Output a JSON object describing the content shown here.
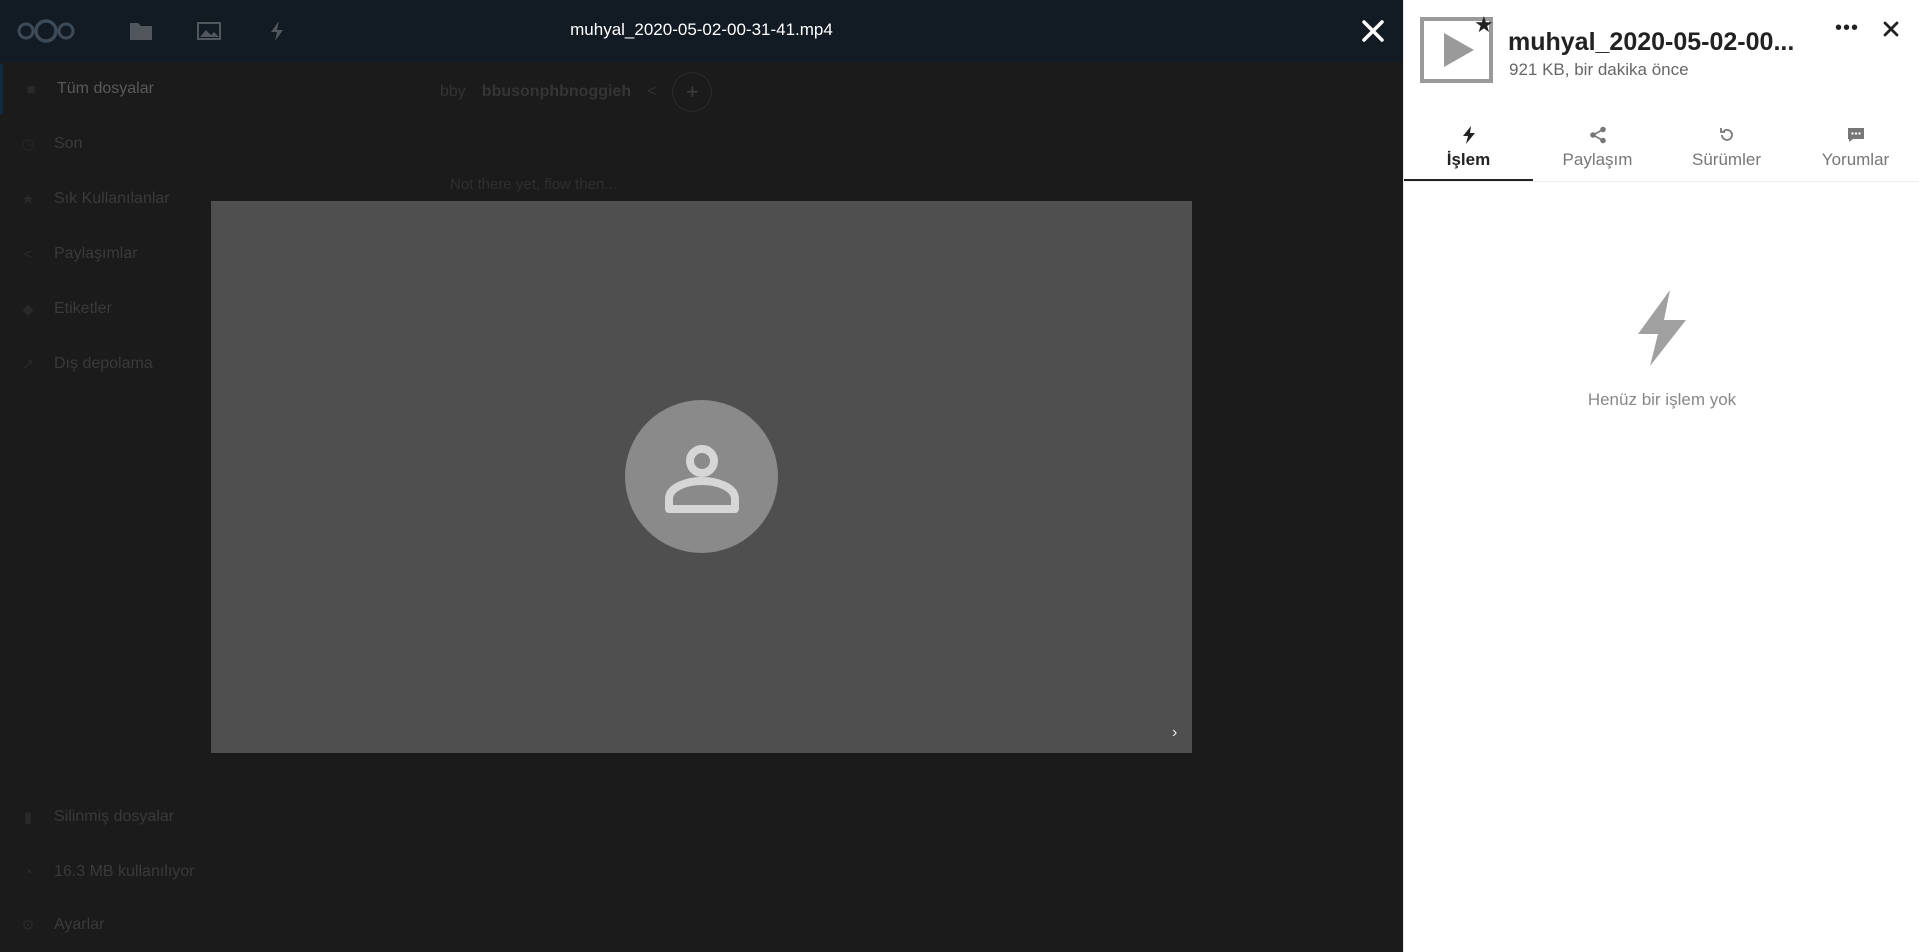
{
  "app": {
    "sidebar": {
      "items": [
        {
          "label": "Tüm dosyalar",
          "icon": "folder-icon"
        },
        {
          "label": "Son",
          "icon": "clock-icon"
        },
        {
          "label": "Sık Kullanılanlar",
          "icon": "star-icon"
        },
        {
          "label": "Paylaşımlar",
          "icon": "share-icon"
        },
        {
          "label": "Etiketler",
          "icon": "tag-icon"
        },
        {
          "label": "Dış depolama",
          "icon": "external-icon"
        }
      ],
      "footer": [
        {
          "label": "Silinmiş dosyalar",
          "icon": "trash-icon"
        },
        {
          "label": "16.3 MB kullanılıyor",
          "icon": "quota-icon"
        },
        {
          "label": "Ayarlar",
          "icon": "gear-icon"
        }
      ]
    },
    "breadcrumb": {
      "root": "bby",
      "current": "bbusonphbnoggieh"
    },
    "empty_hint": "Not there yet, flow then..."
  },
  "viewer": {
    "title": "muhyal_2020-05-02-00-31-41.mp4",
    "next_label": "›"
  },
  "details": {
    "file_name": "muhyal_2020-05-02-00...",
    "meta": "921 KB, bir dakika önce",
    "more_label": "•••",
    "tabs": [
      {
        "label": "İşlem",
        "icon": "lightning-icon"
      },
      {
        "label": "Paylaşım",
        "icon": "share-icon"
      },
      {
        "label": "Sürümler",
        "icon": "history-icon"
      },
      {
        "label": "Yorumlar",
        "icon": "comment-icon"
      }
    ],
    "empty_text": "Henüz bir işlem yok"
  },
  "colors": {
    "accent": "#0082c9",
    "overlay": "#1b1b1b",
    "video_bg": "#4f4f4f"
  }
}
